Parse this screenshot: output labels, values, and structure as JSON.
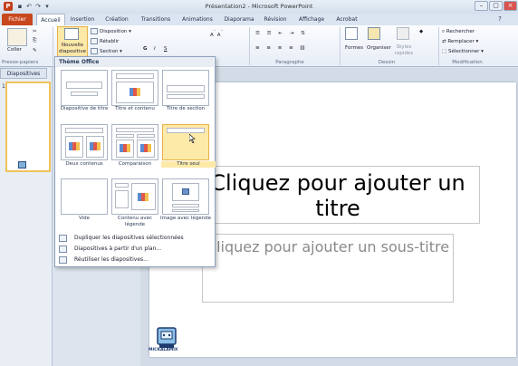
{
  "window": {
    "title": "Présentation2 - Microsoft PowerPoint",
    "logo_letter": "P"
  },
  "tabs": [
    {
      "label": "Fichier"
    },
    {
      "label": "Accueil"
    },
    {
      "label": "Insertion"
    },
    {
      "label": "Création"
    },
    {
      "label": "Transitions"
    },
    {
      "label": "Animations"
    },
    {
      "label": "Diaporama"
    },
    {
      "label": "Révision"
    },
    {
      "label": "Affichage"
    },
    {
      "label": "Acrobat"
    }
  ],
  "ribbon": {
    "coller": "Coller",
    "nouvelle_diapositive": "Nouvelle diapositive",
    "disposition": "Disposition",
    "retablir": "Rétablir",
    "section": "Section",
    "formes": "Formes",
    "organiser": "Organiser",
    "styles_rapides": "Styles rapides",
    "rechercher": "Rechercher",
    "remplacer": "Remplacer",
    "selectionner": "Sélectionner",
    "group_presse_papiers": "Presse-papiers",
    "group_paragraphe": "Paragraphe",
    "group_dessin": "Dessin",
    "group_modification": "Modification"
  },
  "left_pane": {
    "tab_label": "Diapositives",
    "thumb_number": "1"
  },
  "gallery": {
    "title": "Thème Office",
    "layouts": [
      {
        "label": "Diapositive de titre"
      },
      {
        "label": "Titre et contenu"
      },
      {
        "label": "Titre de section"
      },
      {
        "label": "Deux contenus"
      },
      {
        "label": "Comparaison"
      },
      {
        "label": "Titre seul"
      },
      {
        "label": "Vide"
      },
      {
        "label": "Contenu avec légende"
      },
      {
        "label": "Image avec légende"
      }
    ],
    "menu": [
      {
        "label": "Dupliquer les diapositives sélectionnées"
      },
      {
        "label": "Diapositives à partir d'un plan..."
      },
      {
        "label": "Réutiliser les diapositives..."
      }
    ]
  },
  "slide": {
    "title_placeholder": "Cliquez pour ajouter un titre",
    "subtitle_placeholder": "Cliquez pour ajouter un sous-titre"
  },
  "watermark": {
    "text": "MICKALAMIX"
  },
  "colors": {
    "file_tab": "#c8471d",
    "selection": "#fde9a8"
  }
}
